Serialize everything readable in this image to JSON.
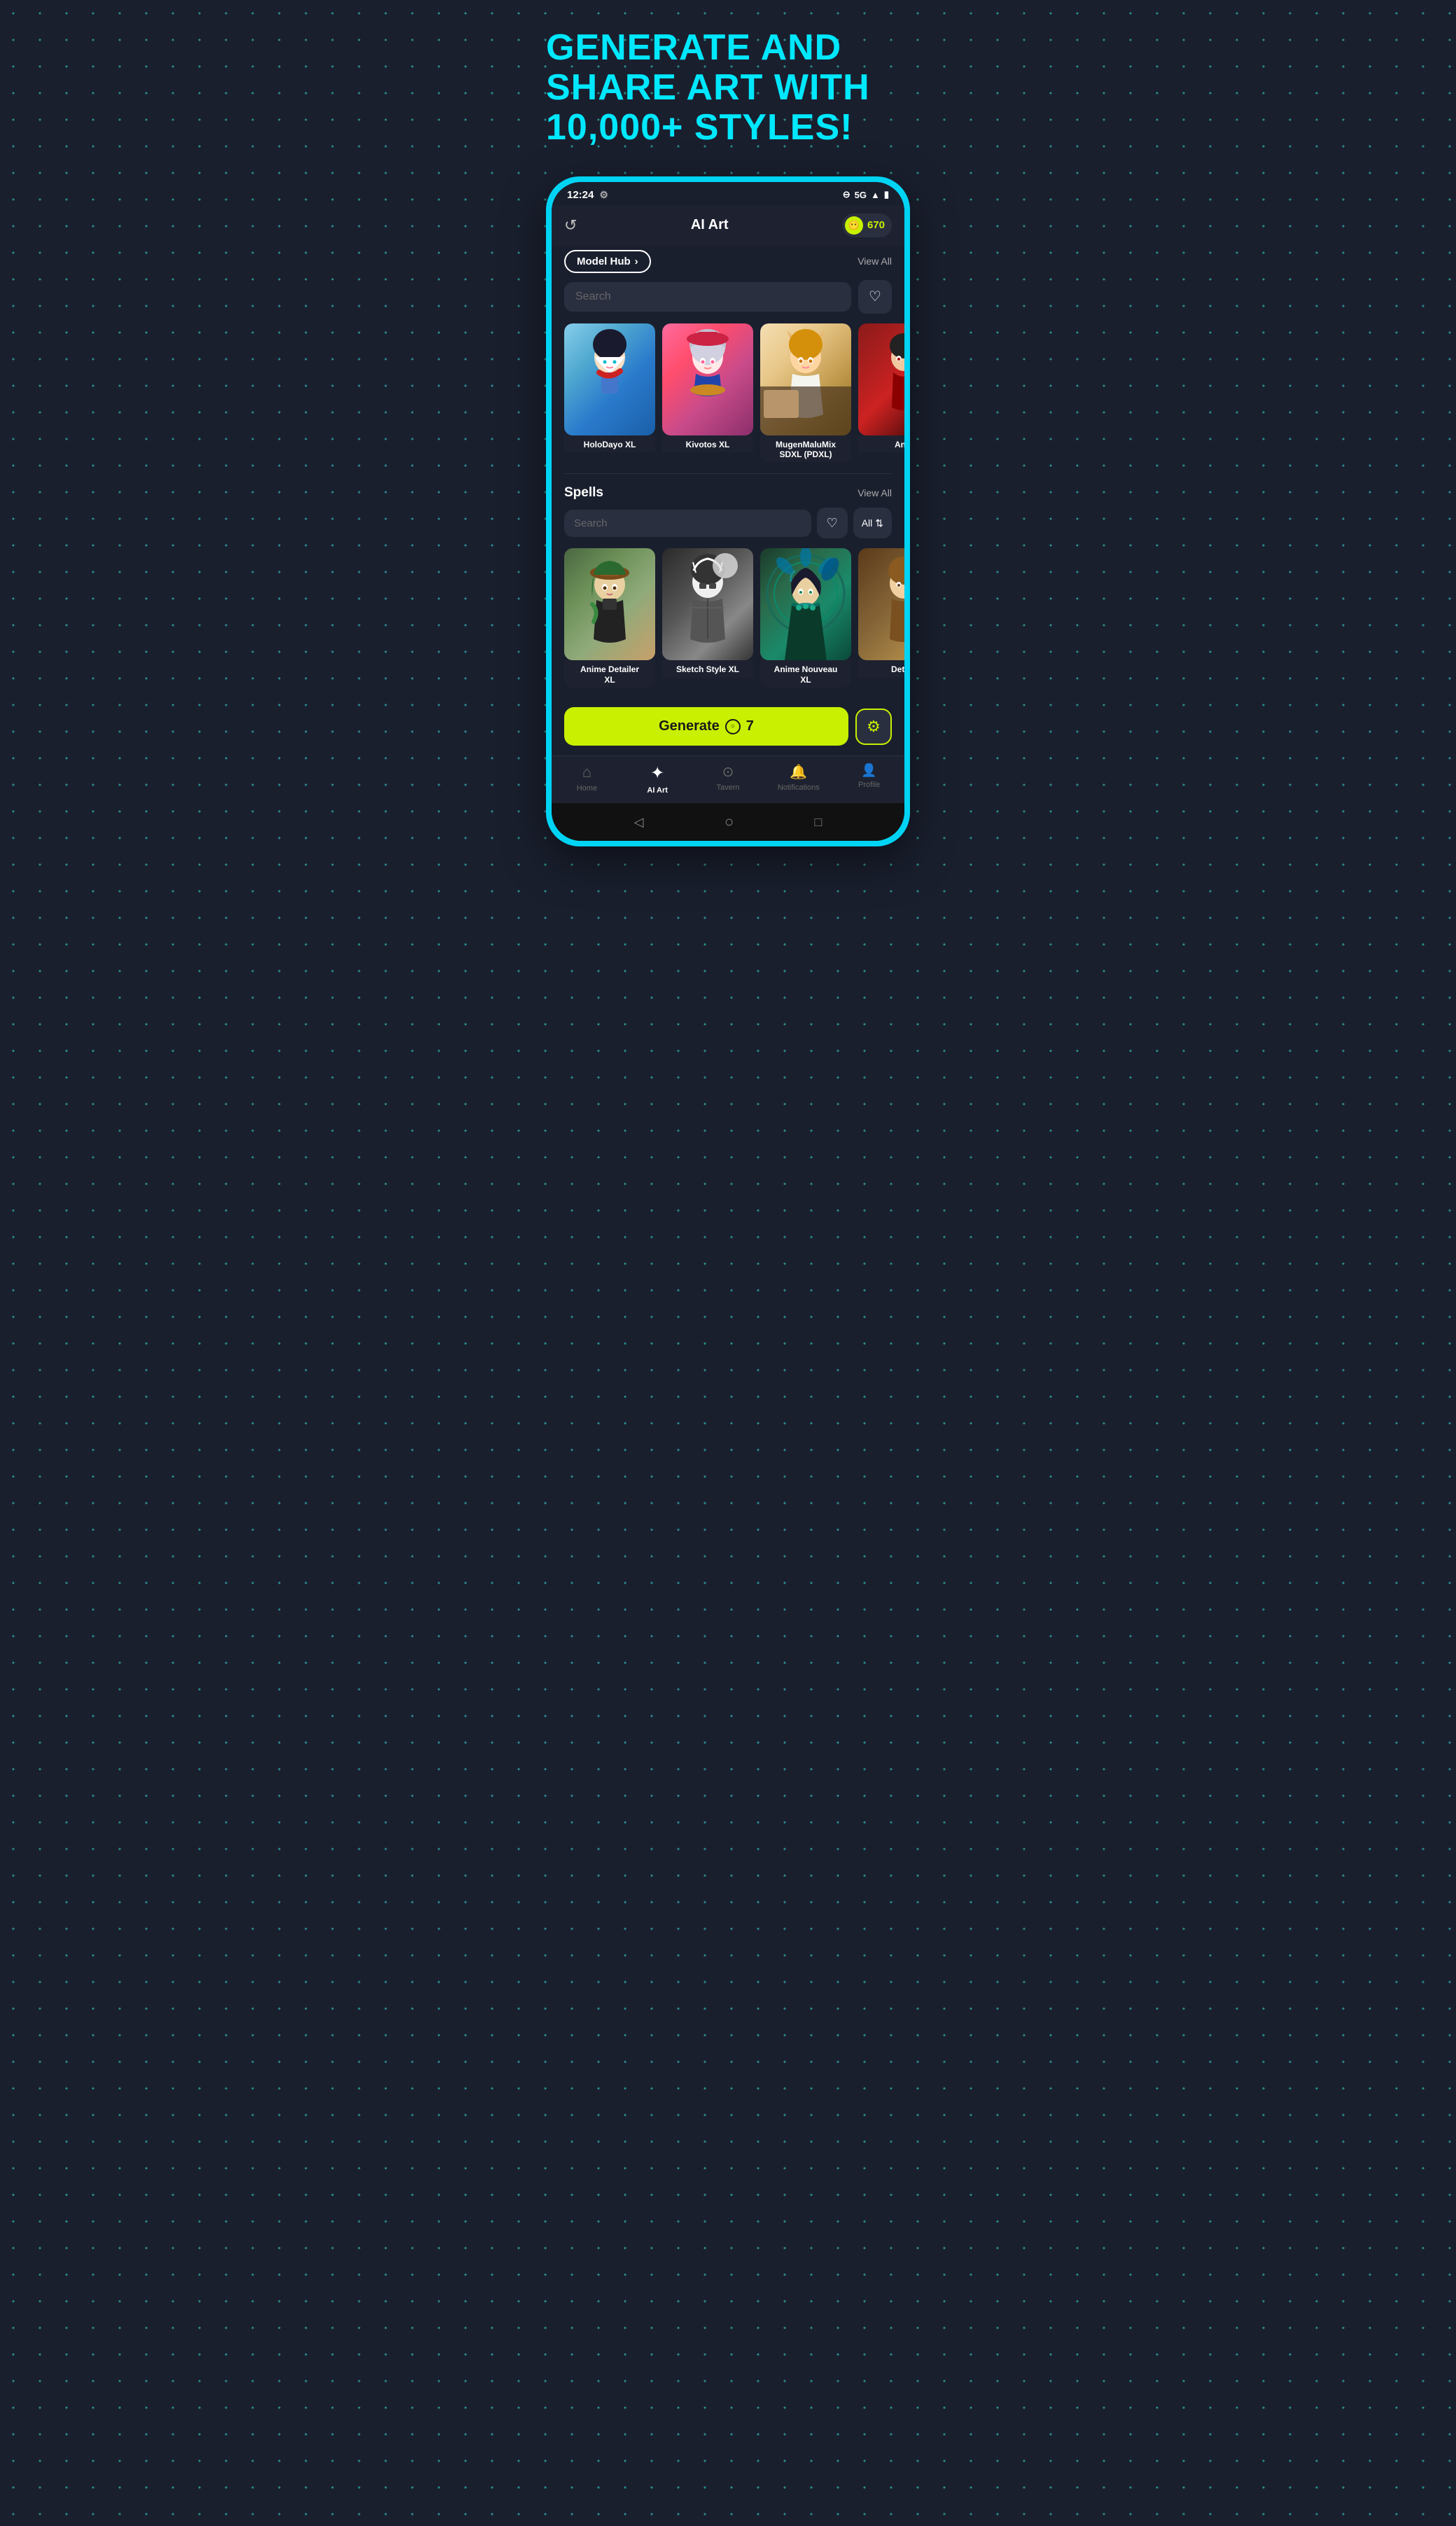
{
  "headline": "GENERATE AND\nSHARE ART WITH\n10,000+ STYLES!",
  "status": {
    "time": "12:24",
    "network": "5G",
    "settings_icon": "⚙"
  },
  "header": {
    "history_icon": "↺",
    "title": "AI Art",
    "coin_icon": "😶",
    "coin_count": "670"
  },
  "model_hub": {
    "label": "Model Hub",
    "arrow": "›",
    "view_all": "View All",
    "search_placeholder": "Search",
    "heart_icon": "♡"
  },
  "models": [
    {
      "name": "HoloDayo XL",
      "img_class": "card-img-1"
    },
    {
      "name": "Kivotos XL",
      "img_class": "card-img-2"
    },
    {
      "name": "MugenMaluMix SDXL (PDXL)",
      "img_class": "card-img-3"
    },
    {
      "name": "An...",
      "img_class": "card-img-4"
    }
  ],
  "spells": {
    "title": "Spells",
    "view_all": "View All",
    "search_placeholder": "Search",
    "heart_icon": "♡",
    "filter_label": "All",
    "filter_arrow": "⇅"
  },
  "spell_cards": [
    {
      "name": "Anime Detailer XL",
      "img_class": "card-img-5"
    },
    {
      "name": "Sketch Style XL",
      "img_class": "card-img-6"
    },
    {
      "name": "Anime Nouveau XL",
      "img_class": "card-img-7"
    },
    {
      "name": "Deta...",
      "img_class": "card-img-8"
    }
  ],
  "generate": {
    "label": "Generate",
    "coin_icon": "○",
    "coin_count": "7",
    "settings_icon": "⚙"
  },
  "nav": {
    "items": [
      {
        "id": "home",
        "icon": "⌂",
        "label": "Home",
        "active": false
      },
      {
        "id": "ai-art",
        "icon": "✦",
        "label": "AI Art",
        "active": true
      },
      {
        "id": "tavern",
        "icon": "⊛",
        "label": "Tavern",
        "active": false
      },
      {
        "id": "notifications",
        "icon": "🔔",
        "label": "Notifications",
        "active": false
      },
      {
        "id": "profile",
        "icon": "👤",
        "label": "Profile",
        "active": false
      }
    ]
  },
  "phone_bottom": {
    "back": "◁",
    "home": "○",
    "recent": "□"
  }
}
